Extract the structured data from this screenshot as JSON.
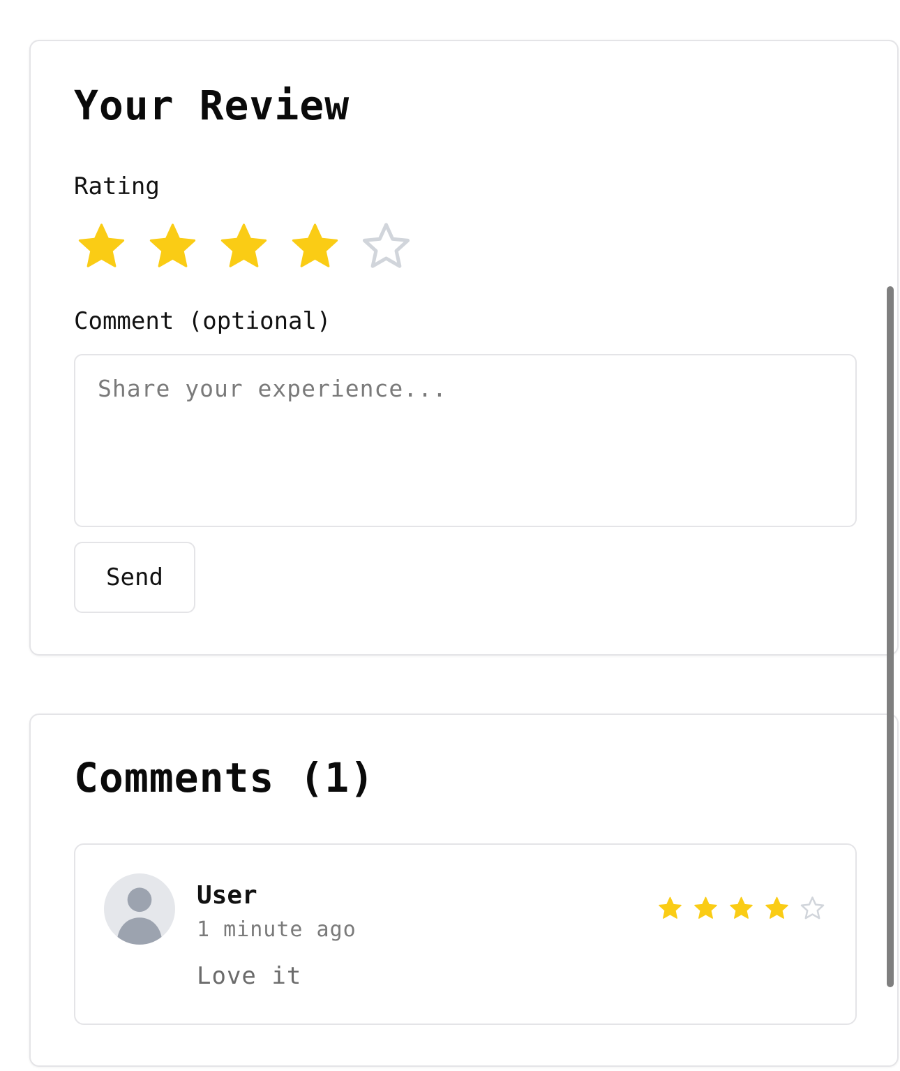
{
  "review_form": {
    "title": "Your Review",
    "rating_label": "Rating",
    "rating": {
      "value": 4,
      "max": 5
    },
    "comment_label": "Comment (optional)",
    "comment_value": "",
    "comment_placeholder": "Share your experience...",
    "send_label": "Send"
  },
  "comments": {
    "title": "Comments (1)",
    "items": [
      {
        "user": "User",
        "time": "1 minute ago",
        "text": "Love it",
        "rating": 4,
        "rating_max": 5,
        "avatar_icon": "user-avatar-icon"
      }
    ]
  },
  "icons": {
    "star_filled": "star-filled-icon",
    "star_empty": "star-empty-icon"
  },
  "colors": {
    "star_filled": "#facc15",
    "star_empty": "#d1d5db",
    "border": "#e4e4e7",
    "avatar_bg": "#e5e7eb",
    "avatar_fg": "#9ca3af",
    "muted_text": "#7a7a7a"
  }
}
